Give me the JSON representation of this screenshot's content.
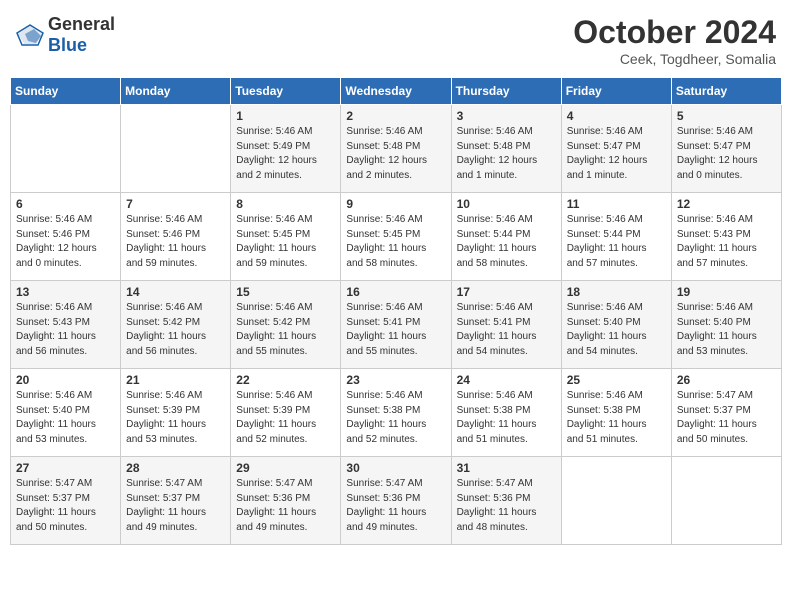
{
  "header": {
    "logo_general": "General",
    "logo_blue": "Blue",
    "main_title": "October 2024",
    "subtitle": "Ceek, Togdheer, Somalia"
  },
  "columns": [
    "Sunday",
    "Monday",
    "Tuesday",
    "Wednesday",
    "Thursday",
    "Friday",
    "Saturday"
  ],
  "weeks": [
    [
      {
        "day": "",
        "info": ""
      },
      {
        "day": "",
        "info": ""
      },
      {
        "day": "1",
        "info": "Sunrise: 5:46 AM\nSunset: 5:49 PM\nDaylight: 12 hours\nand 2 minutes."
      },
      {
        "day": "2",
        "info": "Sunrise: 5:46 AM\nSunset: 5:48 PM\nDaylight: 12 hours\nand 2 minutes."
      },
      {
        "day": "3",
        "info": "Sunrise: 5:46 AM\nSunset: 5:48 PM\nDaylight: 12 hours\nand 1 minute."
      },
      {
        "day": "4",
        "info": "Sunrise: 5:46 AM\nSunset: 5:47 PM\nDaylight: 12 hours\nand 1 minute."
      },
      {
        "day": "5",
        "info": "Sunrise: 5:46 AM\nSunset: 5:47 PM\nDaylight: 12 hours\nand 0 minutes."
      }
    ],
    [
      {
        "day": "6",
        "info": "Sunrise: 5:46 AM\nSunset: 5:46 PM\nDaylight: 12 hours\nand 0 minutes."
      },
      {
        "day": "7",
        "info": "Sunrise: 5:46 AM\nSunset: 5:46 PM\nDaylight: 11 hours\nand 59 minutes."
      },
      {
        "day": "8",
        "info": "Sunrise: 5:46 AM\nSunset: 5:45 PM\nDaylight: 11 hours\nand 59 minutes."
      },
      {
        "day": "9",
        "info": "Sunrise: 5:46 AM\nSunset: 5:45 PM\nDaylight: 11 hours\nand 58 minutes."
      },
      {
        "day": "10",
        "info": "Sunrise: 5:46 AM\nSunset: 5:44 PM\nDaylight: 11 hours\nand 58 minutes."
      },
      {
        "day": "11",
        "info": "Sunrise: 5:46 AM\nSunset: 5:44 PM\nDaylight: 11 hours\nand 57 minutes."
      },
      {
        "day": "12",
        "info": "Sunrise: 5:46 AM\nSunset: 5:43 PM\nDaylight: 11 hours\nand 57 minutes."
      }
    ],
    [
      {
        "day": "13",
        "info": "Sunrise: 5:46 AM\nSunset: 5:43 PM\nDaylight: 11 hours\nand 56 minutes."
      },
      {
        "day": "14",
        "info": "Sunrise: 5:46 AM\nSunset: 5:42 PM\nDaylight: 11 hours\nand 56 minutes."
      },
      {
        "day": "15",
        "info": "Sunrise: 5:46 AM\nSunset: 5:42 PM\nDaylight: 11 hours\nand 55 minutes."
      },
      {
        "day": "16",
        "info": "Sunrise: 5:46 AM\nSunset: 5:41 PM\nDaylight: 11 hours\nand 55 minutes."
      },
      {
        "day": "17",
        "info": "Sunrise: 5:46 AM\nSunset: 5:41 PM\nDaylight: 11 hours\nand 54 minutes."
      },
      {
        "day": "18",
        "info": "Sunrise: 5:46 AM\nSunset: 5:40 PM\nDaylight: 11 hours\nand 54 minutes."
      },
      {
        "day": "19",
        "info": "Sunrise: 5:46 AM\nSunset: 5:40 PM\nDaylight: 11 hours\nand 53 minutes."
      }
    ],
    [
      {
        "day": "20",
        "info": "Sunrise: 5:46 AM\nSunset: 5:40 PM\nDaylight: 11 hours\nand 53 minutes."
      },
      {
        "day": "21",
        "info": "Sunrise: 5:46 AM\nSunset: 5:39 PM\nDaylight: 11 hours\nand 53 minutes."
      },
      {
        "day": "22",
        "info": "Sunrise: 5:46 AM\nSunset: 5:39 PM\nDaylight: 11 hours\nand 52 minutes."
      },
      {
        "day": "23",
        "info": "Sunrise: 5:46 AM\nSunset: 5:38 PM\nDaylight: 11 hours\nand 52 minutes."
      },
      {
        "day": "24",
        "info": "Sunrise: 5:46 AM\nSunset: 5:38 PM\nDaylight: 11 hours\nand 51 minutes."
      },
      {
        "day": "25",
        "info": "Sunrise: 5:46 AM\nSunset: 5:38 PM\nDaylight: 11 hours\nand 51 minutes."
      },
      {
        "day": "26",
        "info": "Sunrise: 5:47 AM\nSunset: 5:37 PM\nDaylight: 11 hours\nand 50 minutes."
      }
    ],
    [
      {
        "day": "27",
        "info": "Sunrise: 5:47 AM\nSunset: 5:37 PM\nDaylight: 11 hours\nand 50 minutes."
      },
      {
        "day": "28",
        "info": "Sunrise: 5:47 AM\nSunset: 5:37 PM\nDaylight: 11 hours\nand 49 minutes."
      },
      {
        "day": "29",
        "info": "Sunrise: 5:47 AM\nSunset: 5:36 PM\nDaylight: 11 hours\nand 49 minutes."
      },
      {
        "day": "30",
        "info": "Sunrise: 5:47 AM\nSunset: 5:36 PM\nDaylight: 11 hours\nand 49 minutes."
      },
      {
        "day": "31",
        "info": "Sunrise: 5:47 AM\nSunset: 5:36 PM\nDaylight: 11 hours\nand 48 minutes."
      },
      {
        "day": "",
        "info": ""
      },
      {
        "day": "",
        "info": ""
      }
    ]
  ]
}
